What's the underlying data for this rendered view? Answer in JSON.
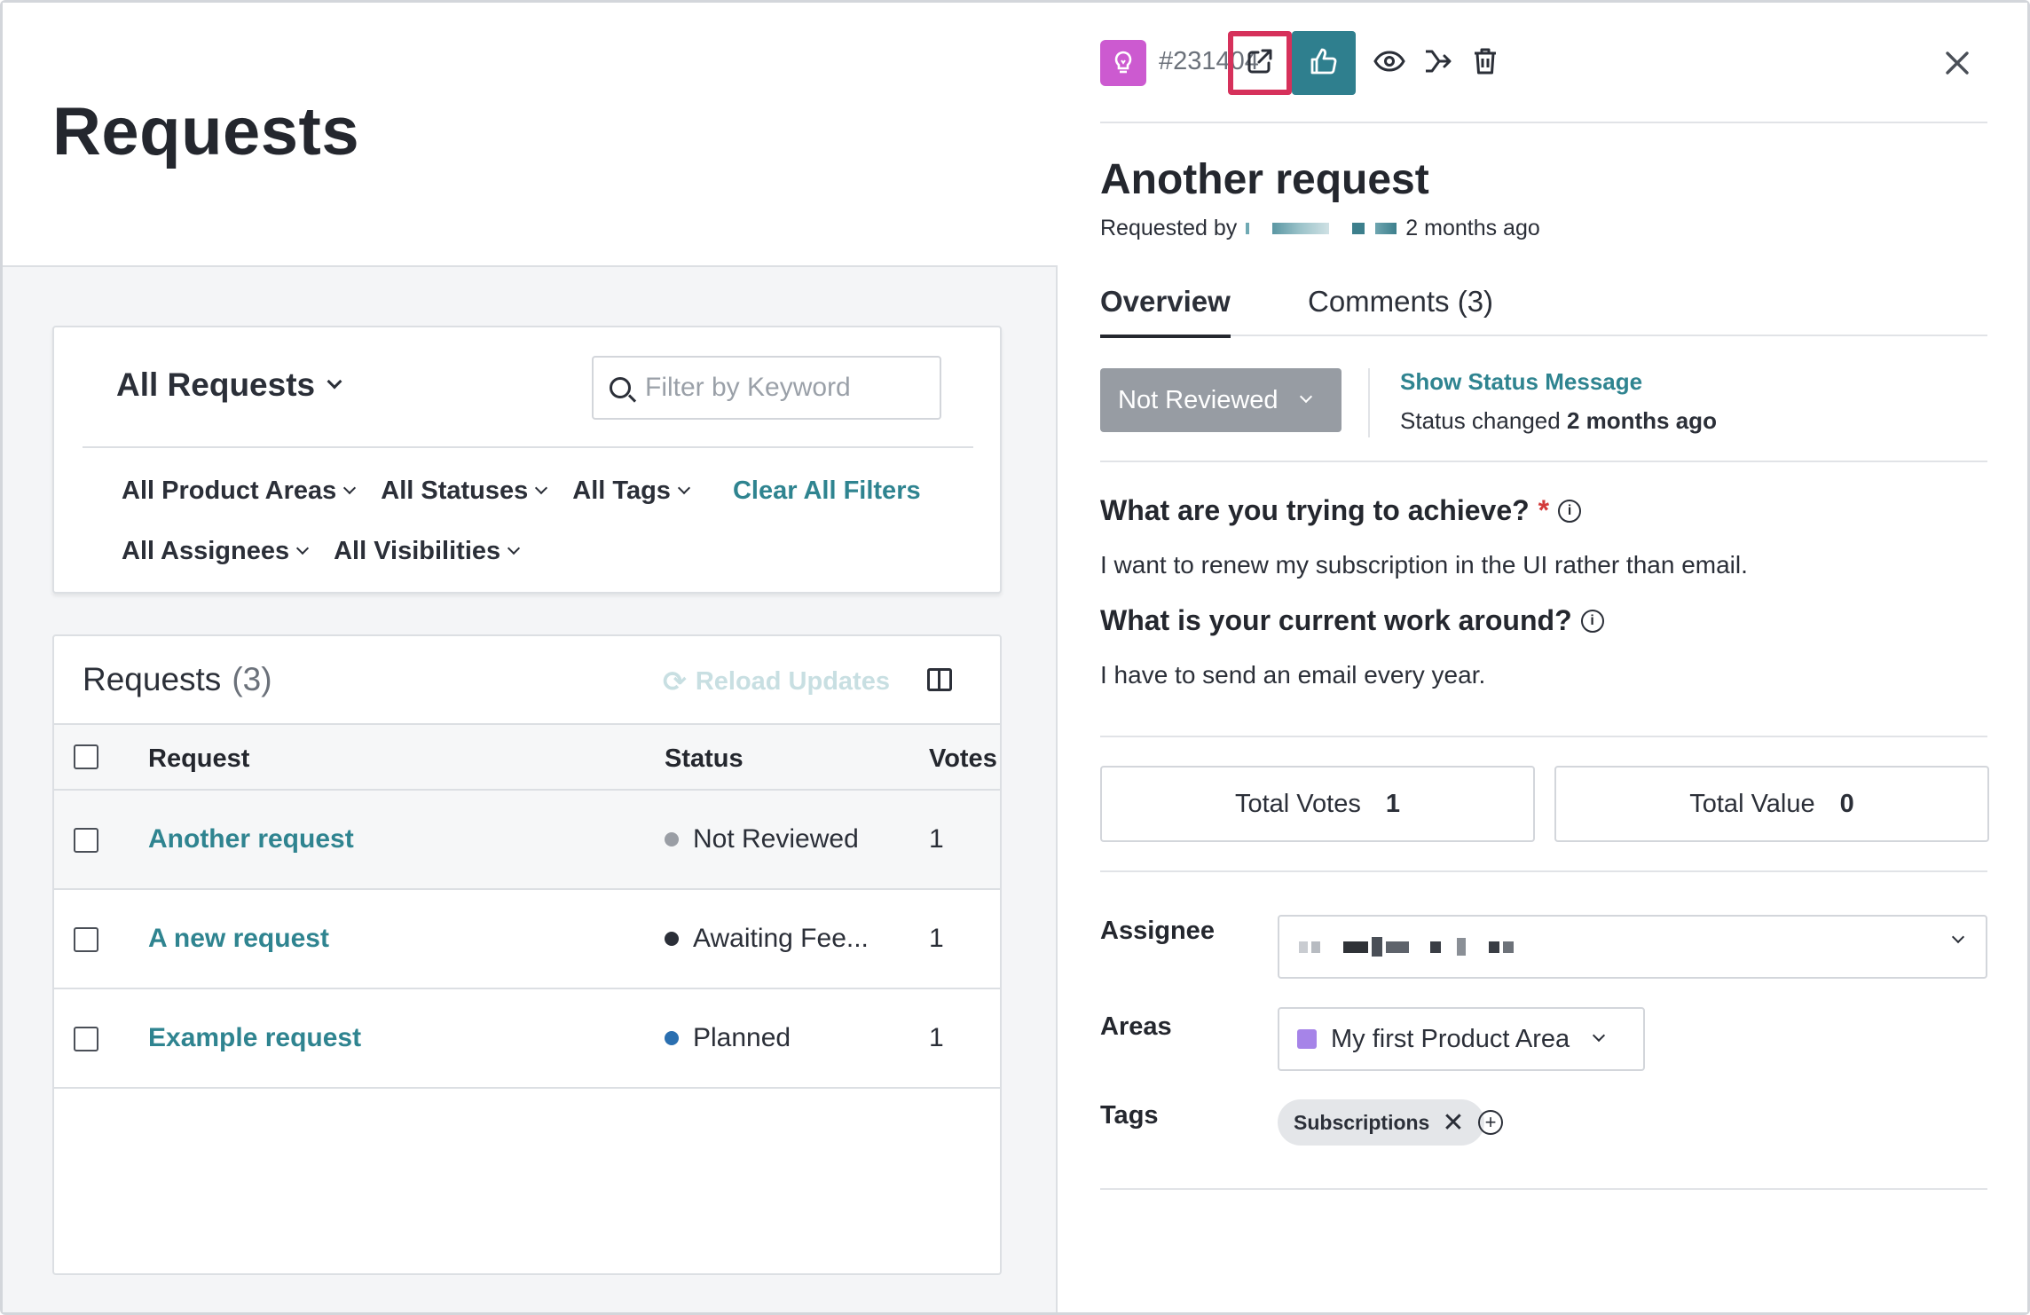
{
  "left": {
    "page_title": "Requests",
    "view_selector": "All Requests",
    "keyword_filter": {
      "placeholder": "Filter by Keyword",
      "value": ""
    },
    "filters_row1": [
      "All Product Areas",
      "All Statuses",
      "All Tags"
    ],
    "clear_filters": "Clear All Filters",
    "filters_row2": [
      "All Assignees",
      "All Visibilities"
    ],
    "list": {
      "title": "Requests",
      "count": "(3)",
      "reload_label": "Reload Updates",
      "columns": {
        "request": "Request",
        "status": "Status",
        "votes": "Votes"
      },
      "rows": [
        {
          "title": "Another request",
          "status": "Not Reviewed",
          "status_color": "#9a9ea5",
          "votes": "1"
        },
        {
          "title": "A new request",
          "status": "Awaiting Fee...",
          "status_color": "#2b2f38",
          "votes": "1"
        },
        {
          "title": "Example request",
          "status": "Planned",
          "status_color": "#2a6fb0",
          "votes": "1"
        }
      ]
    }
  },
  "detail": {
    "request_id": "#231404",
    "title": "Another request",
    "requested_by_label": "Requested by",
    "requested_time": "2 months ago",
    "tabs": [
      "Overview",
      "Comments (3)"
    ],
    "status": "Not Reviewed",
    "show_status_message": "Show Status Message",
    "status_changed_prefix": "Status changed",
    "status_changed_time": "2 months ago",
    "questions": [
      {
        "label": "What are you trying to achieve?",
        "required": "*",
        "answer": "I want to renew my subscription in the UI rather than email."
      },
      {
        "label": "What is your current work around?",
        "required": "",
        "answer": "I have to send an email every year."
      }
    ],
    "total_votes_label": "Total Votes",
    "total_votes": "1",
    "total_value_label": "Total Value",
    "total_value": "0",
    "assignee_label": "Assignee",
    "areas_label": "Areas",
    "area_value": "My first Product Area",
    "tags_label": "Tags",
    "tags": [
      "Subscriptions"
    ]
  },
  "colors": {
    "accent": "#2f7f8e",
    "link": "#2f8490",
    "highlight": "#d6315b",
    "idea_icon": "#cc5ad0"
  },
  "icons": [
    "idea-bulb-icon",
    "external-link-icon",
    "thumbs-up-icon",
    "eye-icon",
    "merge-icon",
    "trash-icon",
    "close-icon",
    "search-icon",
    "reload-icon",
    "columns-icon",
    "info-icon",
    "plus-circle-icon"
  ]
}
